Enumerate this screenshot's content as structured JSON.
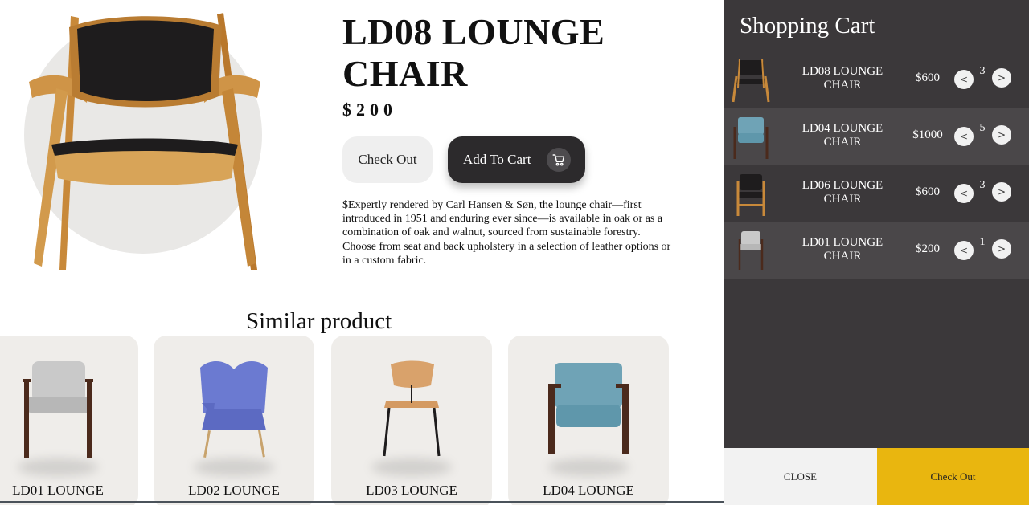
{
  "product": {
    "title": "LD08 LOUNGE CHAIR",
    "price": "$200",
    "checkout_label": "Check Out",
    "add_to_cart_label": "Add To Cart",
    "description": "$Expertly rendered by Carl Hansen & Søn, the lounge chair—first introduced in 1951 and enduring ever since—is available in oak or as a combination of oak and walnut, sourced from sustainable forestry. Choose from seat and back upholstery in a selection of leather options or in a custom fabric.",
    "image": "oak-leather-lounge-chair"
  },
  "similar": {
    "title": "Similar product",
    "items": [
      {
        "label": "LD01 LOUNGE",
        "image": "grey-armchair"
      },
      {
        "label": "LD02 LOUNGE",
        "image": "blue-wingback-chair"
      },
      {
        "label": "LD03 LOUNGE",
        "image": "wood-side-chair"
      },
      {
        "label": "LD04 LOUNGE",
        "image": "teal-lounge-chair"
      }
    ]
  },
  "cart": {
    "title": "Shopping Cart",
    "decrement_glyph": "<",
    "increment_glyph": ">",
    "items": [
      {
        "name": "LD08 LOUNGE CHAIR",
        "price": "$600",
        "qty": "3",
        "image": "oak-leather-lounge-chair"
      },
      {
        "name": "LD04 LOUNGE CHAIR",
        "price": "$1000",
        "qty": "5",
        "image": "teal-lounge-chair"
      },
      {
        "name": "LD06 LOUNGE CHAIR",
        "price": "$600",
        "qty": "3",
        "image": "black-oak-armchair"
      },
      {
        "name": "LD01 LOUNGE CHAIR",
        "price": "$200",
        "qty": "1",
        "image": "grey-armchair"
      }
    ],
    "close_label": "CLOSE",
    "checkout_label": "Check Out"
  },
  "colors": {
    "cart_bg": "#3b383a",
    "cart_row_alt": "#4a4749",
    "checkout_accent": "#e9b60f",
    "add_button_bg": "#2c2a2c"
  }
}
